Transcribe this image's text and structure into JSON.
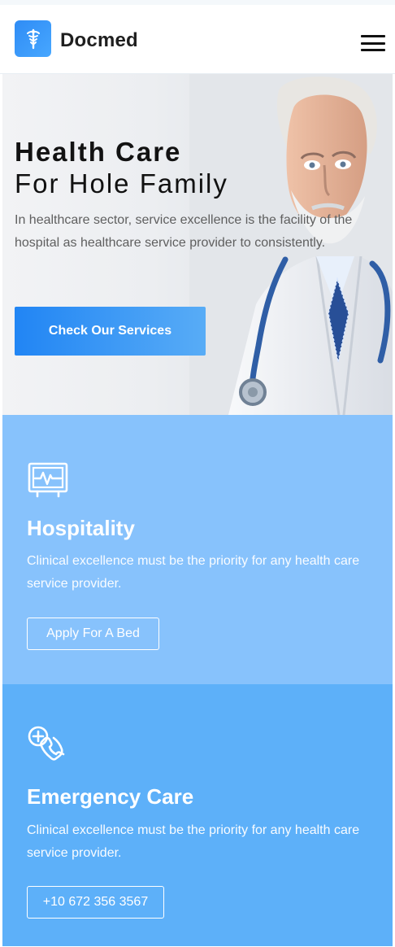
{
  "brand": {
    "name": "Docmed"
  },
  "hero": {
    "title_line_1": "Health Care",
    "title_line_2": "For Hole Family",
    "description": "In healthcare sector, service excellence is the facility of the hospital as healthcare service provider to consistently.",
    "button_label": "Check Our Services"
  },
  "services": [
    {
      "icon": "heart-monitor-icon",
      "title": "Hospitality",
      "description": "Clinical excellence must be the priority for any health care service provider.",
      "button_label": "Apply For A Bed"
    },
    {
      "icon": "emergency-phone-icon",
      "title": "Emergency Care",
      "description": "Clinical excellence must be the priority for any health care service provider.",
      "button_label": "+10 672 356 3567"
    }
  ],
  "colors": {
    "brand_blue": "#2f8cf5",
    "hero_button_start": "#2185f4",
    "hero_button_end": "#58acf6",
    "service_light": "#87c2fc",
    "service_dark": "#5db0f9"
  }
}
